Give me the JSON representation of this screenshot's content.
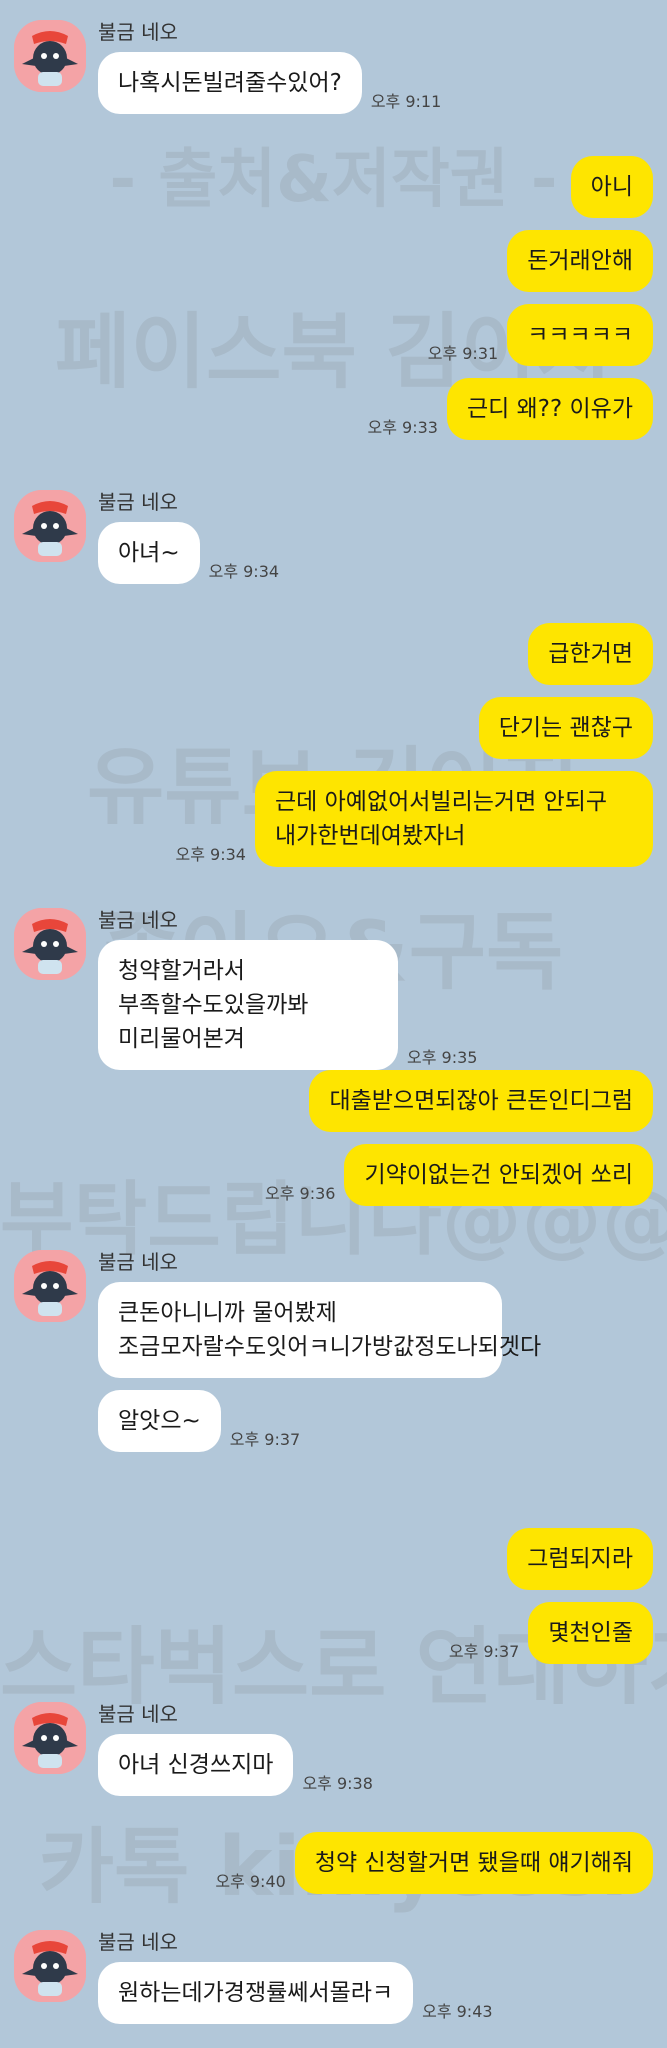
{
  "sender_name": "불금 네오",
  "watermarks": [
    "- 출처&저작권 -",
    "페이스북 김이지",
    "유튜브 김이지",
    "좋아요&구독",
    "부탁드립니다@@@",
    "스타벅스로 연대하기",
    "카톡 kimyeosi"
  ],
  "messages": {
    "m1": {
      "text": "나혹시돈빌려줄수있어?",
      "time": "오후 9:11"
    },
    "m2": {
      "text": "아니"
    },
    "m3": {
      "text": "돈거래안해"
    },
    "m4": {
      "text": "ㅋㅋㅋㅋㅋ",
      "time": "오후 9:31"
    },
    "m5": {
      "text": "근디 왜?? 이유가",
      "time": "오후 9:33"
    },
    "m6": {
      "text": "아녀~",
      "time": "오후 9:34"
    },
    "m7": {
      "text": "급한거면"
    },
    "m8": {
      "text": "단기는 괜찮구"
    },
    "m9": {
      "text": "근데 아예없어서빌리는거면 안되구 내가한번데여봤자너",
      "time": "오후 9:34"
    },
    "m10": {
      "text": "청약할거라서 부족할수도있을까봐 미리물어본겨",
      "time": "오후 9:35"
    },
    "m11": {
      "text": "대출받으면되잖아 큰돈인디그럼"
    },
    "m12": {
      "text": "기약이없는건 안되겠어 쏘리",
      "time": "오후 9:36"
    },
    "m13": {
      "text": "큰돈아니니까 물어봤제 조금모자랄수도잇어ㅋ니가방값정도나되겟다"
    },
    "m14": {
      "text": "알앗으~",
      "time": "오후 9:37"
    },
    "m15": {
      "text": "그럼되지라"
    },
    "m16": {
      "text": "몇천인줄",
      "time": "오후 9:37"
    },
    "m17": {
      "text": "아녀 신경쓰지마",
      "time": "오후 9:38"
    },
    "m18": {
      "text": "청약 신청할거면 됐을때 얘기해줘",
      "time": "오후 9:40"
    },
    "m19": {
      "text": "원하는데가경쟁률쎄서몰라ㅋ",
      "time": "오후 9:43"
    }
  },
  "colors": {
    "background": "#b2c7d9",
    "incoming_bubble": "#ffffff",
    "outgoing_bubble": "#fee500",
    "avatar_bg": "#f4a3a6"
  }
}
